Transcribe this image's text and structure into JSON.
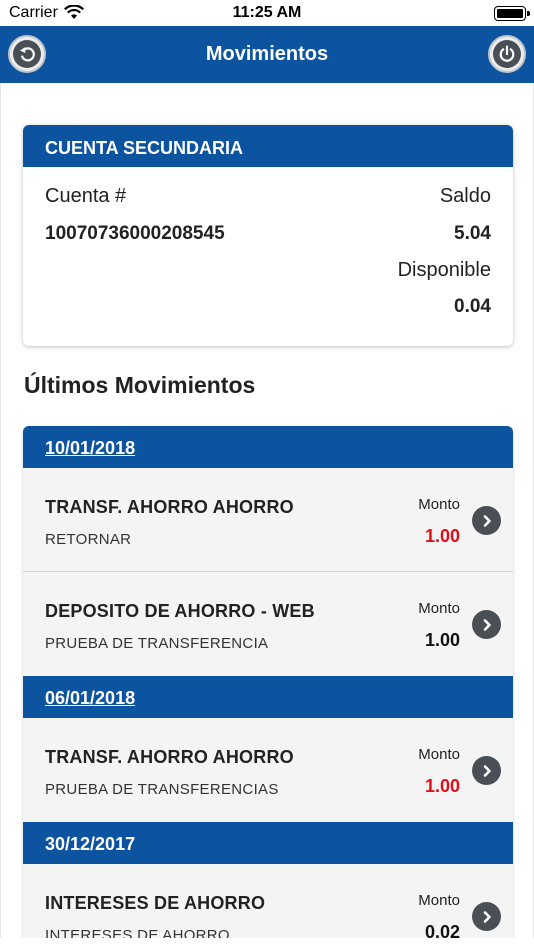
{
  "status_bar": {
    "carrier": "Carrier",
    "time": "11:25 AM"
  },
  "nav": {
    "title": "Movimientos",
    "back_icon": "back-arrow-icon",
    "power_icon": "power-icon"
  },
  "account": {
    "header": "CUENTA SECUNDARIA",
    "account_label": "Cuenta #",
    "account_number": "10070736000208545",
    "balance_label": "Saldo",
    "balance_value": "5.04",
    "available_label": "Disponible",
    "available_value": "0.04"
  },
  "section_title": "Últimos Movimientos",
  "groups": [
    {
      "date": "10/01/2018",
      "items": [
        {
          "description": "TRANSF. AHORRO AHORRO",
          "detail": "RETORNAR",
          "amount_label": "Monto",
          "amount": "1.00",
          "amount_color": "#e0101a"
        },
        {
          "description": "DEPOSITO DE AHORRO - WEB",
          "detail": "PRUEBA DE TRANSFERENCIA",
          "amount_label": "Monto",
          "amount": "1.00",
          "amount_color": "#111111"
        }
      ]
    },
    {
      "date": "06/01/2018",
      "items": [
        {
          "description": "TRANSF. AHORRO AHORRO",
          "detail": "PRUEBA DE TRANSFERENCIAS",
          "amount_label": "Monto",
          "amount": "1.00",
          "amount_color": "#e0101a"
        }
      ]
    },
    {
      "date": "30/12/2017",
      "items": [
        {
          "description": "INTERESES DE AHORRO",
          "detail": "INTERESES DE AHORRO",
          "amount_label": "Monto",
          "amount": "0.02",
          "amount_color": "#111111"
        }
      ]
    }
  ],
  "colors": {
    "brand_blue": "#0c53a0",
    "debit_red": "#e0101a"
  }
}
